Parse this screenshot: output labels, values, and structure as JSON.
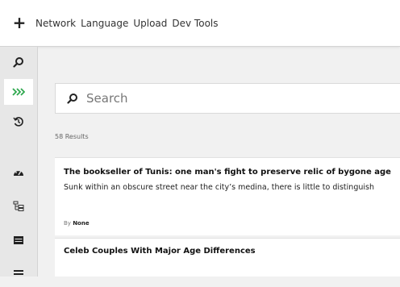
{
  "topbar": {
    "add_label": "+",
    "menu": [
      "Network",
      "Language",
      "Upload",
      "Dev Tools"
    ]
  },
  "sidebar": {
    "items": [
      {
        "icon": "search-icon"
      },
      {
        "icon": "chevrons-icon",
        "active": true,
        "color": "#2fa84f"
      },
      {
        "icon": "history-icon"
      },
      {
        "icon": "dashboard-icon"
      },
      {
        "icon": "tree-icon"
      },
      {
        "icon": "list-icon"
      },
      {
        "icon": "menu-icon"
      }
    ]
  },
  "search": {
    "placeholder": "Search"
  },
  "results": {
    "count_text": "58 Results",
    "items": [
      {
        "title": "The bookseller of Tunis: one man's fight to preserve relic of bygone age",
        "description": "Sunk within an obscure street near the city’s medina, there is little to distinguish",
        "by_prefix": "By",
        "author": "None"
      },
      {
        "title": "Celeb Couples With Major Age Differences"
      }
    ]
  }
}
